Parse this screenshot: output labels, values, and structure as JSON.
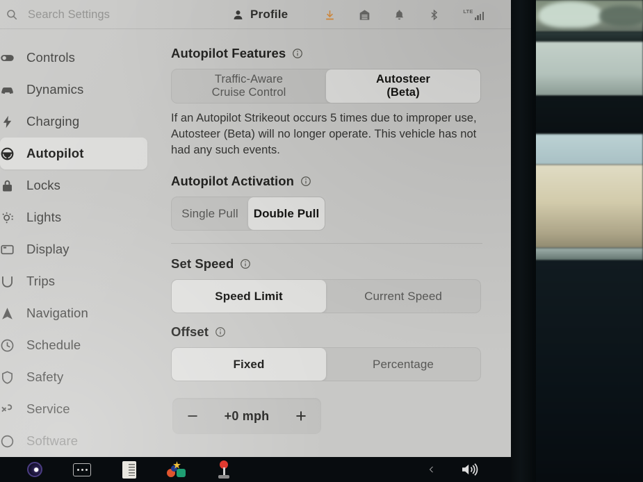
{
  "header": {
    "search": {
      "placeholder": "Search Settings",
      "value": "",
      "icon": "search-icon"
    },
    "profile": {
      "label": "Profile",
      "icon": "person-icon"
    },
    "status": [
      {
        "name": "software-download-icon",
        "label": "Software Update Download"
      },
      {
        "name": "garage-icon",
        "label": "Home / Garage"
      },
      {
        "name": "bell-icon",
        "label": "Notifications"
      },
      {
        "name": "bluetooth-icon",
        "label": "Bluetooth"
      }
    ],
    "connectivity": {
      "network": "LTE",
      "bars": 4
    }
  },
  "sidebar": {
    "items": [
      {
        "label": "Controls",
        "icon": "toggle-icon",
        "active": false,
        "dim": false
      },
      {
        "label": "Dynamics",
        "icon": "car-icon",
        "active": false,
        "dim": false
      },
      {
        "label": "Charging",
        "icon": "bolt-icon",
        "active": false,
        "dim": false
      },
      {
        "label": "Autopilot",
        "icon": "steering-wheel-icon",
        "active": true,
        "dim": false
      },
      {
        "label": "Locks",
        "icon": "lock-icon",
        "active": false,
        "dim": false
      },
      {
        "label": "Lights",
        "icon": "light-icon",
        "active": false,
        "dim": false
      },
      {
        "label": "Display",
        "icon": "display-icon",
        "active": false,
        "dim": false
      },
      {
        "label": "Trips",
        "icon": "trips-icon",
        "active": false,
        "dim": false
      },
      {
        "label": "Navigation",
        "icon": "navigation-icon",
        "active": false,
        "dim": false
      },
      {
        "label": "Schedule",
        "icon": "clock-icon",
        "active": false,
        "dim": false
      },
      {
        "label": "Safety",
        "icon": "shield-icon",
        "active": false,
        "dim": false
      },
      {
        "label": "Service",
        "icon": "wrench-icon",
        "active": false,
        "dim": false
      },
      {
        "label": "Software",
        "icon": "software-icon",
        "active": false,
        "dim": true
      }
    ]
  },
  "main": {
    "features": {
      "title": "Autopilot Features",
      "info_icon": "info-icon",
      "options": [
        {
          "line1": "Traffic-Aware",
          "line2": "Cruise Control",
          "selected": false
        },
        {
          "line1": "Autosteer",
          "line2": "(Beta)",
          "selected": true
        }
      ],
      "note": "If an Autopilot Strikeout occurs 5 times due to improper use, Autosteer (Beta) will no longer operate. This vehicle has not had any such events."
    },
    "activation": {
      "title": "Autopilot Activation",
      "info_icon": "info-icon",
      "options": [
        {
          "line1": "Single Pull",
          "line2": "",
          "selected": false
        },
        {
          "line1": "Double Pull",
          "line2": "",
          "selected": true
        }
      ]
    },
    "set_speed": {
      "title": "Set Speed",
      "info_icon": "info-icon",
      "options": [
        {
          "line1": "Speed Limit",
          "line2": "",
          "selected": true
        },
        {
          "line1": "Current Speed",
          "line2": "",
          "selected": false
        }
      ]
    },
    "offset": {
      "title": "Offset",
      "info_icon": "info-icon",
      "options": [
        {
          "line1": "Fixed",
          "line2": "",
          "selected": true
        },
        {
          "line1": "Percentage",
          "line2": "",
          "selected": false
        }
      ],
      "stepper": {
        "decrement": "−",
        "value": "+0 mph",
        "increment": "+"
      }
    }
  },
  "taskbar": {
    "items": [
      {
        "name": "brightness-icon",
        "label": "Brightness"
      },
      {
        "name": "more-dots-icon",
        "label": "More"
      },
      {
        "name": "manual-icon",
        "label": "Owner's Manual"
      },
      {
        "name": "toybox-icon",
        "label": "Toybox"
      },
      {
        "name": "joystick-icon",
        "label": "Arcade"
      }
    ],
    "right": [
      {
        "name": "chevron-left-icon",
        "label": "Expand"
      },
      {
        "name": "volume-icon",
        "label": "Volume"
      }
    ]
  },
  "colors": {
    "screen_bg": "#c8c8c6",
    "selected_segment": "#dfdfdd",
    "unselected_segment": "#c2c2c0",
    "accent_download": "#d98d3e",
    "taskbar_bg": "#080c0f"
  }
}
